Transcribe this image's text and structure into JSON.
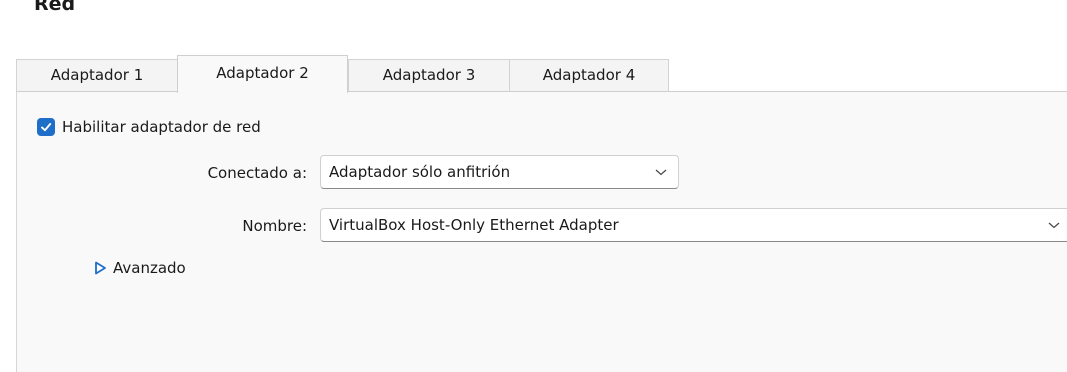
{
  "section": {
    "title": "Red"
  },
  "tabs": [
    {
      "label": "Adaptador 1",
      "active": false
    },
    {
      "label": "Adaptador 2",
      "active": true
    },
    {
      "label": "Adaptador 3",
      "active": false
    },
    {
      "label": "Adaptador 4",
      "active": false
    }
  ],
  "adapter": {
    "enable_label": "Habilitar adaptador de red",
    "enabled": true,
    "attached_label": "Conectado a:",
    "attached_value": "Adaptador sólo anfitrión",
    "name_label": "Nombre:",
    "name_value": "VirtualBox Host-Only Ethernet Adapter",
    "advanced_label": "Avanzado"
  },
  "colors": {
    "accent": "#1f6fc9",
    "panel_bg": "#f9f9f9",
    "tab_bg": "#f4f4f4"
  }
}
